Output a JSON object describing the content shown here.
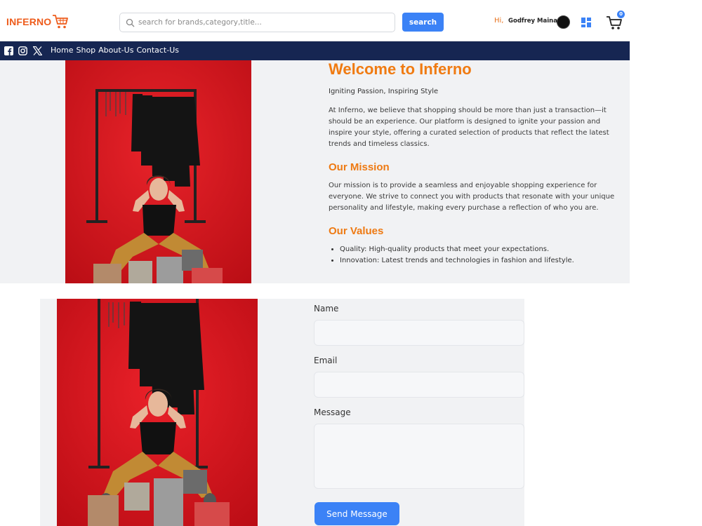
{
  "header": {
    "logo": "INFERNO",
    "search": {
      "placeholder": "search for brands,category,title...",
      "value": ""
    },
    "search_button": "search",
    "greeting": "Hi,",
    "user_name": "Godfrey Maina",
    "cart_count": "0"
  },
  "navbar": {
    "social": [
      "facebook-icon",
      "instagram-icon",
      "x-icon"
    ],
    "links": [
      "Home",
      "Shop",
      "About-Us",
      "Contact-Us"
    ]
  },
  "about": {
    "title": "Welcome to Inferno",
    "tagline": "Igniting Passion, Inspiring Style",
    "intro": "At Inferno, we believe that shopping should be more than just a transaction—it should be an experience. Our platform is designed to ignite your passion and inspire your style, offering a curated selection of products that reflect the latest trends and timeless classics.",
    "mission_heading": "Our Mission",
    "mission_text": "Our mission is to provide a seamless and enjoyable shopping experience for everyone. We strive to connect you with products that resonate with your unique personality and lifestyle, making every purchase a reflection of who you are.",
    "values_heading": "Our Values",
    "values": [
      "Quality: High-quality products that meet your expectations.",
      "Innovation: Latest trends and technologies in fashion and lifestyle."
    ]
  },
  "contact_form": {
    "name_label": "Name",
    "email_label": "Email",
    "message_label": "Message",
    "submit": "Send Message"
  },
  "colors": {
    "brand_orange": "#ee5c1c",
    "heading_orange": "#f07b12",
    "nav_bg": "#162652",
    "accent_blue": "#3b82f6",
    "hero_red": "#d8141c"
  }
}
